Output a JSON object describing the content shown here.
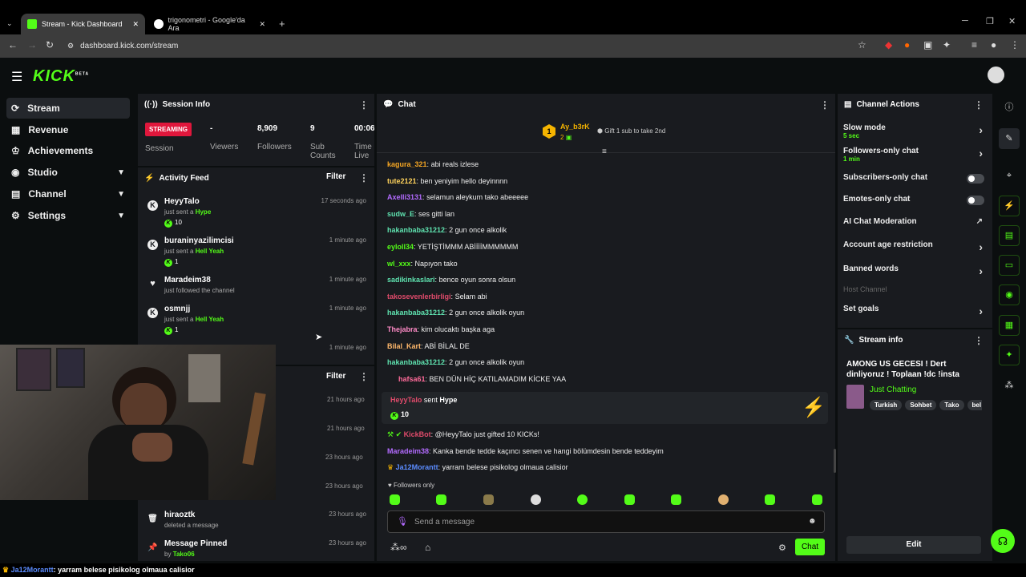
{
  "browser": {
    "tabs": [
      {
        "title": "Stream - Kick Dashboard",
        "active": true
      },
      {
        "title": "trigonometri - Google'da Ara",
        "active": false
      }
    ],
    "url": "dashboard.kick.com/stream"
  },
  "brand": {
    "logo": "KICK",
    "beta": "BETA",
    "accent": "#53fc18"
  },
  "sidebar": {
    "items": [
      {
        "label": "Stream",
        "icon": "stream-icon"
      },
      {
        "label": "Revenue",
        "icon": "revenue-icon"
      },
      {
        "label": "Achievements",
        "icon": "trophy-icon"
      },
      {
        "label": "Studio",
        "icon": "studio-icon"
      },
      {
        "label": "Channel",
        "icon": "channel-icon"
      },
      {
        "label": "Settings",
        "icon": "gear-icon"
      }
    ]
  },
  "session": {
    "title": "Session Info",
    "badge": "STREAMING",
    "session_label": "Session",
    "viewers_value": "-",
    "viewers_label": "Viewers",
    "followers_value": "8,909",
    "followers_label": "Followers",
    "subs_value": "9",
    "subs_label": "Sub Counts",
    "time_value": "00:06",
    "time_label": "Time Live"
  },
  "activity": {
    "title": "Activity Feed",
    "filter": "Filter",
    "items": [
      {
        "name": "HeyyTalo",
        "action": "just sent a",
        "item": "Hype",
        "amount": "10",
        "time": "17 seconds ago"
      },
      {
        "name": "buraninyazilimcisi",
        "action": "just sent a",
        "item": "Hell Yeah",
        "amount": "1",
        "time": "1 minute ago"
      },
      {
        "name": "Maradeim38",
        "action": "just followed the channel",
        "item": "",
        "amount": "",
        "time": "1 minute ago"
      },
      {
        "name": "osmnjj",
        "action": "just sent a",
        "item": "Hell Yeah",
        "amount": "1",
        "time": "1 minute ago"
      },
      {
        "name": "",
        "action": "",
        "item": "",
        "amount": "",
        "time": "1 minute ago"
      }
    ]
  },
  "activity2": {
    "filter": "Filter",
    "times": [
      "21 hours ago",
      "21 hours ago",
      "23 hours ago",
      "23 hours ago"
    ],
    "items": [
      {
        "name": "hiraoztk",
        "action": "deleted a message",
        "time": "23 hours ago"
      },
      {
        "name": "Message Pinned",
        "action": "by",
        "by": "Tako06",
        "time": "23 hours ago"
      }
    ]
  },
  "chat": {
    "title": "Chat",
    "top_gifter": {
      "name": "Ay_b3rK",
      "rank": "1",
      "count": "2",
      "hint": "Gift 1 sub to take 2nd"
    },
    "messages": [
      {
        "user": "kagura_321",
        "color": "#f5a623",
        "text": "abi reals izlese"
      },
      {
        "user": "tute2121",
        "color": "#ffd35c",
        "text": "ben yeniyim hello deyinnnn"
      },
      {
        "user": "Axelli3131",
        "color": "#b36bff",
        "text": "selamun aleykum tako abeeeee"
      },
      {
        "user": "sudw_E",
        "color": "#5fe3b0",
        "text": "ses gitti lan"
      },
      {
        "user": "hakanbaba31212",
        "color": "#5fe3b0",
        "text": "2 gun once alkolik"
      },
      {
        "user": "eyloll34",
        "color": "#53fc18",
        "text": "YETİŞTİMMM ABİİİİMMMMMM"
      },
      {
        "user": "wl_xxx",
        "color": "#53fc18",
        "text": "Napıyon tako"
      },
      {
        "user": "sadikinkaslari",
        "color": "#5fe3b0",
        "text": "bence oyun sonra olsun"
      },
      {
        "user": "takosevenlerbirligi",
        "color": "#e04b6b",
        "text": "Selam abi"
      },
      {
        "user": "hakanbaba31212",
        "color": "#5fe3b0",
        "text": "2 gun once alkolik oyun"
      },
      {
        "user": "Thejabra",
        "color": "#ff8bc7",
        "text": "kim olucaktı başka aga"
      },
      {
        "user": "Bilal_Kart",
        "color": "#ffb86b",
        "text": "ABİ BİLAL DE"
      },
      {
        "user": "hakanbaba31212",
        "color": "#5fe3b0",
        "text": "2 gun once alkolik oyun"
      },
      {
        "user": "hafsa61",
        "color": "#ff6b9a",
        "text": "BEN DÜN HİÇ KATILAMADIM KİCKE YAA"
      }
    ],
    "gift": {
      "user": "HeyyTalo",
      "verb": "sent",
      "item": "Hype",
      "amount": "10"
    },
    "messages2": [
      {
        "user": "KickBot",
        "color": "#e04b6b",
        "text": "@HeyyTalo just gifted 10 KICKs!"
      },
      {
        "user": "Maradeim38",
        "color": "#b36bff",
        "text": "Kanka bende tedde kaçıncı senen ve hangi bölümdesin bende teddeyim"
      },
      {
        "user": "Ja12Morantt",
        "color": "#5b8cff",
        "text": "yarram belese pisikolog olmaua calisior"
      }
    ],
    "followers_only": "Followers only",
    "input_placeholder": "Send a message",
    "send_label": "Chat"
  },
  "channel_actions": {
    "title": "Channel Actions",
    "slow_mode": "Slow mode",
    "slow_mode_value": "5 sec",
    "followers_only": "Followers-only chat",
    "followers_only_value": "1 min",
    "subscribers_only": "Subscribers-only chat",
    "emotes_only": "Emotes-only chat",
    "ai_moderation": "AI Chat Moderation",
    "account_age": "Account age restriction",
    "banned_words": "Banned words",
    "host_channel": "Host Channel",
    "set_goals": "Set goals"
  },
  "stream_info": {
    "title": "Stream info",
    "stream_title": "AMONG US GECESI ! Dert dinliyoruz ! Toplaan !dc !insta",
    "category": "Just Chatting",
    "tags": [
      "Turkish",
      "Sohbet",
      "Tako",
      "bel"
    ],
    "edit": "Edit"
  },
  "ticker": {
    "user": "Ja12Morantt",
    "text": ": yarram belese pisikolog olmaua calisior"
  }
}
